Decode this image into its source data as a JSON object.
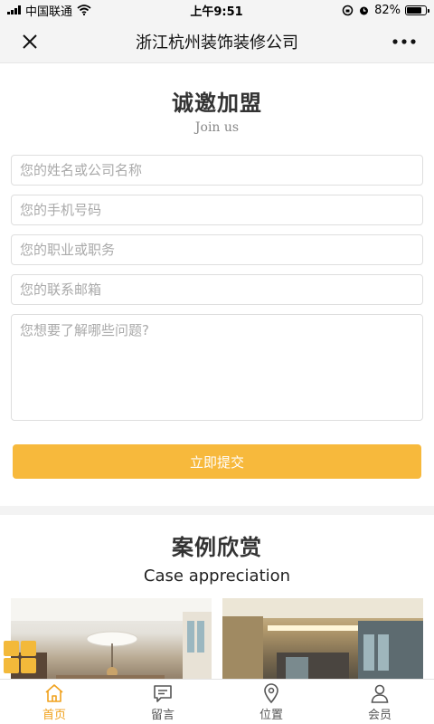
{
  "status_bar": {
    "carrier": "中国联通",
    "time": "上午9:51",
    "battery": "82%",
    "battery_level": 0.82
  },
  "nav": {
    "title": "浙江杭州装饰装修公司",
    "close_icon": "close-icon",
    "more_icon": "more-icon"
  },
  "join": {
    "title": "诚邀加盟",
    "subtitle": "Join us",
    "fields": {
      "name_placeholder": "您的姓名或公司名称",
      "phone_placeholder": "您的手机号码",
      "job_placeholder": "您的职业或职务",
      "email_placeholder": "您的联系邮箱",
      "question_placeholder": "您想要了解哪些问题?"
    },
    "submit_label": "立即提交"
  },
  "cases": {
    "title": "案例欣赏",
    "subtitle": "Case appreciation"
  },
  "tabs": [
    {
      "label": "首页",
      "icon": "home-icon",
      "active": true
    },
    {
      "label": "留言",
      "icon": "message-icon",
      "active": false
    },
    {
      "label": "位置",
      "icon": "location-icon",
      "active": false
    },
    {
      "label": "会员",
      "icon": "user-icon",
      "active": false
    }
  ],
  "colors": {
    "accent": "#f7b93c",
    "tab_active": "#f0a21e"
  }
}
